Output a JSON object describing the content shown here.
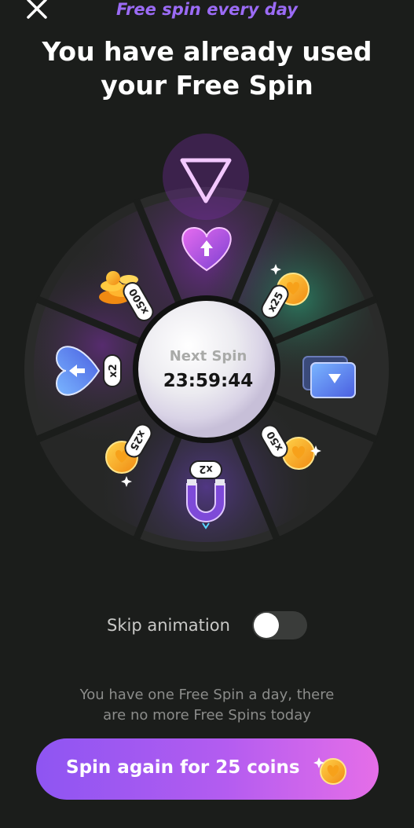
{
  "header": {
    "subtitle": "Free spin every day",
    "title_line1": "You have already used",
    "title_line2": "your Free Spin"
  },
  "wheel": {
    "center_label": "Next Spin",
    "timer": "23:59:44",
    "segments": [
      {
        "reward": "heart-arrow-icon",
        "label": ""
      },
      {
        "reward": "coin-icon",
        "label": "x25"
      },
      {
        "reward": "video-card-icon",
        "label": ""
      },
      {
        "reward": "coin-icon",
        "label": "x50"
      },
      {
        "reward": "magnet-icon",
        "label": "x2"
      },
      {
        "reward": "coin-icon",
        "label": "x25"
      },
      {
        "reward": "heart-back-icon",
        "label": "x2"
      },
      {
        "reward": "coin-pile-icon",
        "label": "x500"
      }
    ]
  },
  "skip": {
    "label": "Skip animation",
    "enabled": false
  },
  "info": {
    "line1": "You have one Free Spin a day, there",
    "line2": "are no more Free Spins today"
  },
  "spin_button": {
    "label": "Spin again for 25 coins"
  },
  "colors": {
    "background": "#1b1d1b",
    "accent_purple": "#9b6bf5",
    "button_start": "#8e55f2",
    "button_end": "#e56ee8"
  }
}
